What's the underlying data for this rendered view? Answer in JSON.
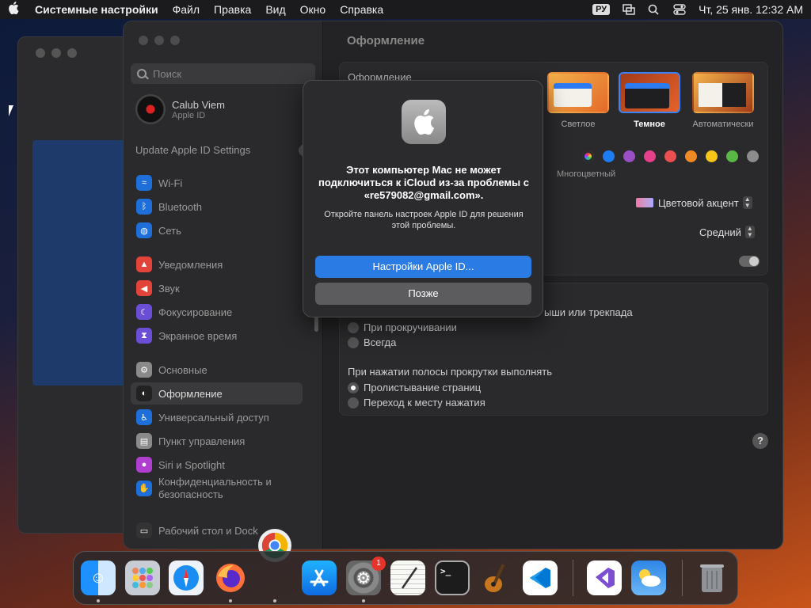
{
  "menubar": {
    "app_name": "Системные настройки",
    "items": [
      "Файл",
      "Правка",
      "Вид",
      "Окно",
      "Справка"
    ],
    "lang": "РУ",
    "datetime": "Чт, 25 янв.  12:32 AM"
  },
  "sidebar": {
    "search_placeholder": "Поиск",
    "user_name": "Calub Viem",
    "user_sub": "Apple ID",
    "update_label": "Update Apple ID Settings",
    "update_count": "1",
    "items": [
      {
        "label": "Wi-Fi",
        "color": "#1e6fd9",
        "glyph": "≈"
      },
      {
        "label": "Bluetooth",
        "color": "#1e6fd9",
        "glyph": "ᛒ"
      },
      {
        "label": "Сеть",
        "color": "#1e6fd9",
        "glyph": "◍"
      },
      {
        "label": "Уведомления",
        "color": "#e2443a",
        "glyph": "▲"
      },
      {
        "label": "Звук",
        "color": "#e2443a",
        "glyph": "◀"
      },
      {
        "label": "Фокусирование",
        "color": "#6a4fd6",
        "glyph": "☾"
      },
      {
        "label": "Экранное время",
        "color": "#6a4fd6",
        "glyph": "⧗"
      },
      {
        "label": "Основные",
        "color": "#8a8a8a",
        "glyph": "⚙"
      },
      {
        "label": "Оформление",
        "color": "#222",
        "glyph": "◐"
      },
      {
        "label": "Универсальный доступ",
        "color": "#1e6fd9",
        "glyph": "♿"
      },
      {
        "label": "Пункт управления",
        "color": "#8a8a8a",
        "glyph": "▤"
      },
      {
        "label": "Siri и Spotlight",
        "color": "#b03fd0",
        "glyph": "●"
      },
      {
        "label": "Конфиденциальность и безопасность",
        "color": "#1e6fd9",
        "glyph": "✋"
      },
      {
        "label": "Рабочий стол и Dock",
        "color": "#333",
        "glyph": "▭"
      }
    ]
  },
  "main": {
    "title": "Оформление",
    "appearance_label": "Оформление",
    "themes": [
      "Светлое",
      "Темное",
      "Автоматически"
    ],
    "multicolor_label": "Многоцветный",
    "accent_colors": [
      "multicolor",
      "#1e7cf3",
      "#9b4fc5",
      "#e7408a",
      "#ec4f50",
      "#f08a24",
      "#f5c518",
      "#5ab847",
      "#8c8c8c"
    ],
    "highlight_label": "Цветовой акцент",
    "sidebar_size": "Средний",
    "scrollbar_partial": "ыши или трекпада",
    "scroll_opt_1": "При прокручивании",
    "scroll_opt_2": "Всегда",
    "click_header": "При нажатии полосы прокрутки выполнять",
    "click_opt_1": "Пролистывание страниц",
    "click_opt_2": "Переход к месту нажатия",
    "help": "?"
  },
  "dialog": {
    "title": "Этот компьютер Mac не может подключиться к iCloud из-за проблемы с «re579082@gmail.com».",
    "message": "Откройте панель настроек Apple ID для решения этой проблемы.",
    "primary_button": "Настройки Apple ID...",
    "secondary_button": "Позже"
  },
  "dock": {
    "apps": [
      "finder",
      "launchpad",
      "safari",
      "firefox",
      "app-store",
      "system-settings",
      "textedit",
      "terminal",
      "garageband",
      "vscode",
      "visual-studio",
      "weather",
      "trash"
    ],
    "settings_badge": "1"
  }
}
